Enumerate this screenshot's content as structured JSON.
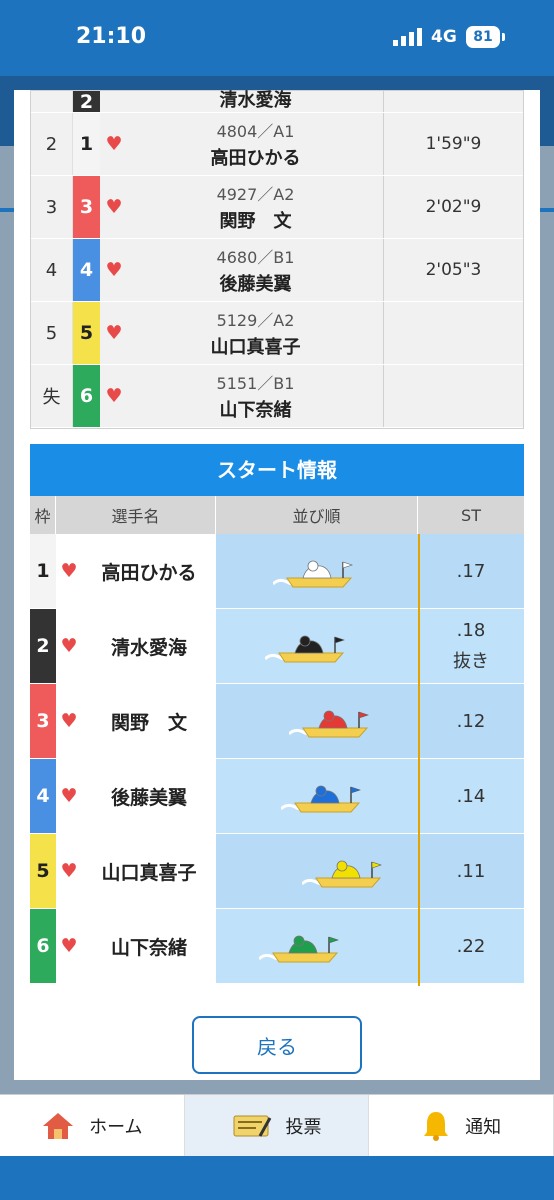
{
  "status": {
    "time": "21:10",
    "network": "4G",
    "battery": "81"
  },
  "results": [
    {
      "rank": "",
      "waku": "2",
      "reg": "",
      "name": "清水愛海",
      "time": ""
    },
    {
      "rank": "2",
      "waku": "1",
      "reg": "4804／A1",
      "name": "高田ひかる",
      "time": "1'59\"9"
    },
    {
      "rank": "3",
      "waku": "3",
      "reg": "4927／A2",
      "name": "関野　文",
      "time": "2'02\"9"
    },
    {
      "rank": "4",
      "waku": "4",
      "reg": "4680／B1",
      "name": "後藤美翼",
      "time": "2'05\"3"
    },
    {
      "rank": "5",
      "waku": "5",
      "reg": "5129／A2",
      "name": "山口真喜子",
      "time": ""
    },
    {
      "rank": "失",
      "waku": "6",
      "reg": "5151／B1",
      "name": "山下奈緒",
      "time": ""
    }
  ],
  "start_info": {
    "title": "スタート情報",
    "headers": {
      "waku": "枠",
      "name": "選手名",
      "order": "並び順",
      "st": "ST"
    },
    "rows": [
      {
        "waku": "1",
        "name": "高田ひかる",
        "st": ".17",
        "note": "",
        "boat_offset": 0.62
      },
      {
        "waku": "2",
        "name": "清水愛海",
        "st": ".18",
        "note": "抜き",
        "boat_offset": 0.58
      },
      {
        "waku": "3",
        "name": "関野　文",
        "st": ".12",
        "note": "",
        "boat_offset": 0.7
      },
      {
        "waku": "4",
        "name": "後藤美翼",
        "st": ".14",
        "note": "",
        "boat_offset": 0.66
      },
      {
        "waku": "5",
        "name": "山口真喜子",
        "st": ".11",
        "note": "",
        "boat_offset": 0.76
      },
      {
        "waku": "6",
        "name": "山下奈緒",
        "st": ".22",
        "note": "",
        "boat_offset": 0.55
      }
    ]
  },
  "back_label": "戻る",
  "nav": {
    "home": "ホーム",
    "vote": "投票",
    "notify": "通知"
  },
  "waku_colors": {
    "1": {
      "bg": "#f4f4f4",
      "fg": "#222222",
      "boat": "#ffffff"
    },
    "2": {
      "bg": "#333333",
      "fg": "#ffffff",
      "boat": "#222222"
    },
    "3": {
      "bg": "#ef5b5b",
      "fg": "#ffffff",
      "boat": "#e53935"
    },
    "4": {
      "bg": "#4a90e2",
      "fg": "#ffffff",
      "boat": "#1e6fd9"
    },
    "5": {
      "bg": "#f5e14a",
      "fg": "#222222",
      "boat": "#f2e000"
    },
    "6": {
      "bg": "#2eaa5c",
      "fg": "#ffffff",
      "boat": "#1f9e4d"
    }
  }
}
